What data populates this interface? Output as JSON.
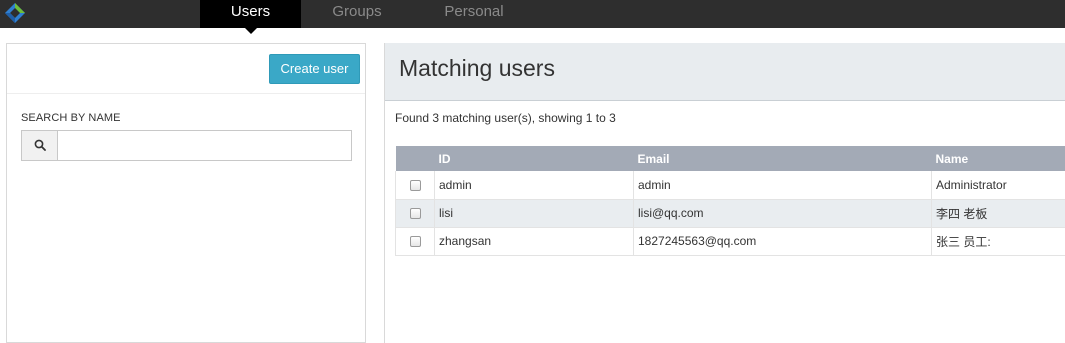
{
  "nav": {
    "logo_icon": "diamond-logo-icon",
    "tabs": [
      {
        "label": "Users",
        "active": true
      },
      {
        "label": "Groups",
        "active": false
      },
      {
        "label": "Personal",
        "active": false
      }
    ]
  },
  "sidebar": {
    "create_button_label": "Create user",
    "search_label": "SEARCH BY NAME",
    "search_icon": "search-icon",
    "search_value": ""
  },
  "main": {
    "title": "Matching users",
    "summary": "Found 3 matching user(s), showing 1 to 3",
    "table": {
      "columns": [
        "ID",
        "Email",
        "Name"
      ],
      "rows": [
        {
          "id": "admin",
          "email": "admin",
          "name": "Administrator",
          "checked": false
        },
        {
          "id": "lisi",
          "email": "lisi@qq.com",
          "name": "李四 老板",
          "checked": false
        },
        {
          "id": "zhangsan",
          "email": "1827245563@qq.com",
          "name": "张三 员工:",
          "checked": false
        }
      ]
    }
  },
  "colors": {
    "topbar": "#2e2e2e",
    "accent_button": "#3aa8c7",
    "table_header": "#a3aab6",
    "header_panel": "#e8ecef"
  }
}
